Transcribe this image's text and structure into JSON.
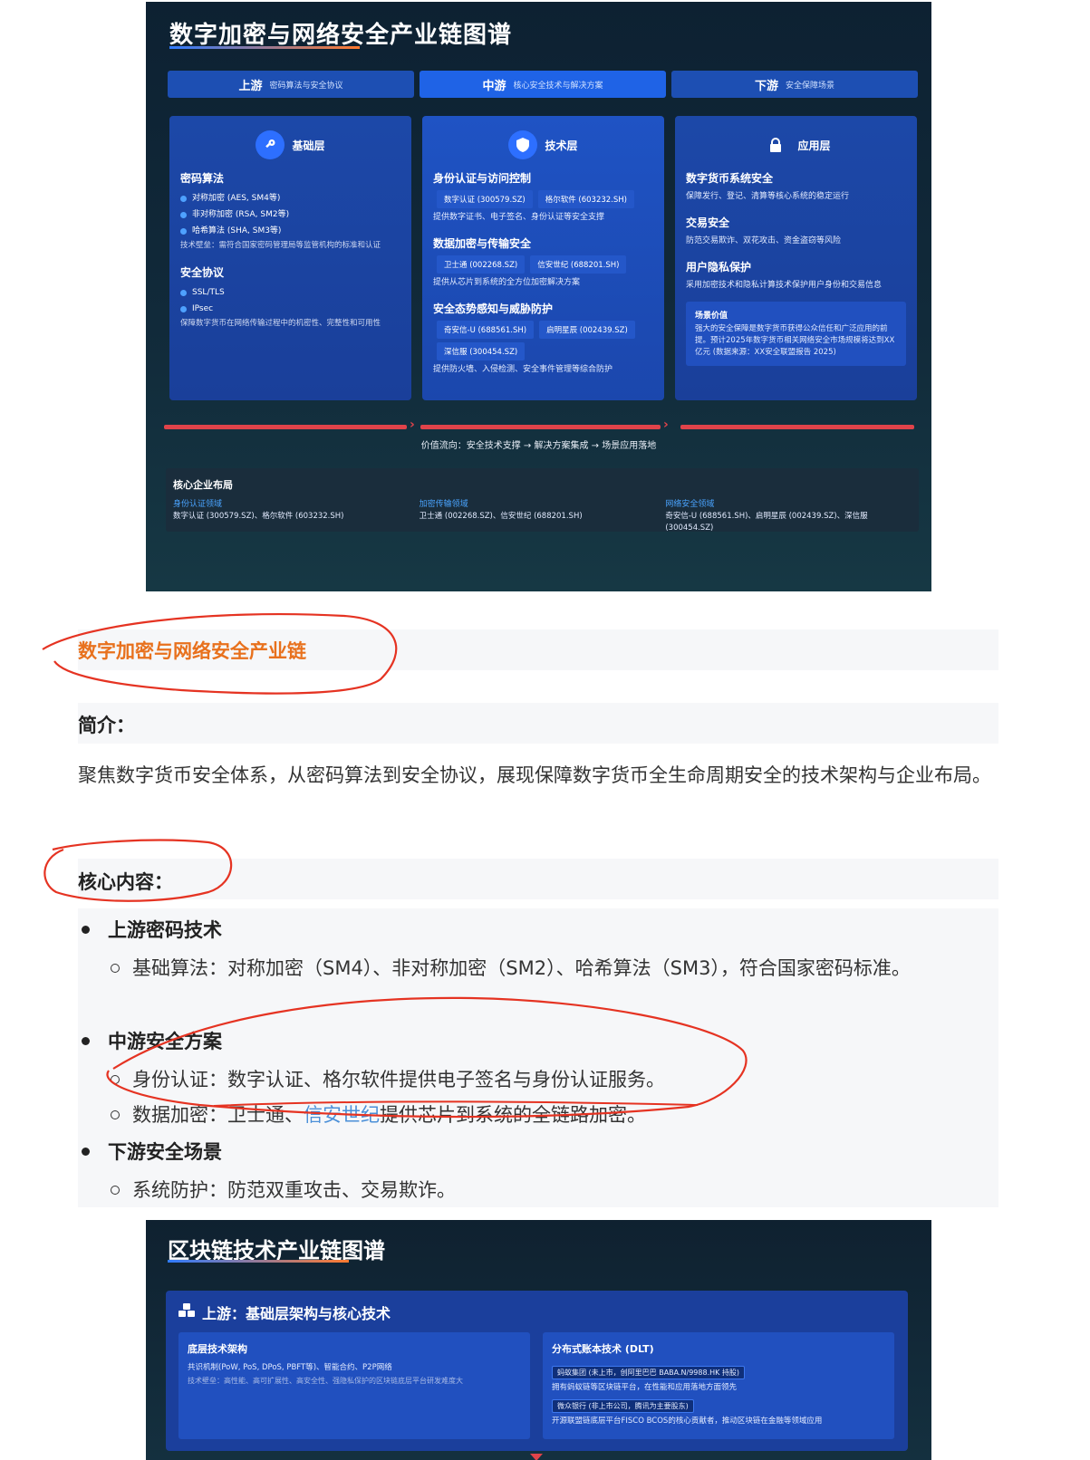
{
  "poster1": {
    "title": "数字加密与网络安全产业链图谱",
    "stages": [
      {
        "name": "上游",
        "desc": "密码算法与安全协议"
      },
      {
        "name": "中游",
        "desc": "核心安全技术与解决方案"
      },
      {
        "name": "下游",
        "desc": "安全保障场景"
      }
    ],
    "columns": {
      "base": {
        "label": "基础层",
        "icon": "key-icon",
        "sec1_title": "密码算法",
        "sec1_items": [
          "对称加密 (AES, SM4等)",
          "非对称加密 (RSA, SM2等)",
          "哈希算法 (SHA, SM3等)"
        ],
        "sec1_note": "技术壁垒：需符合国家密码管理局等监管机构的标准和认证",
        "sec2_title": "安全协议",
        "sec2_items": [
          "SSL/TLS",
          "IPsec"
        ],
        "sec2_note": "保障数字货币在网络传输过程中的机密性、完整性和可用性"
      },
      "tech": {
        "label": "技术层",
        "icon": "shield-icon",
        "s1_title": "身份认证与访问控制",
        "s1_cos": [
          "数字认证 (300579.SZ)",
          "格尔软件 (603232.SH)"
        ],
        "s1_desc": "提供数字证书、电子签名、身份认证等安全支撑",
        "s2_title": "数据加密与传输安全",
        "s2_cos": [
          "卫士通 (002268.SZ)",
          "信安世纪 (688201.SH)"
        ],
        "s2_desc": "提供从芯片到系统的全方位加密解决方案",
        "s3_title": "安全态势感知与威胁防护",
        "s3_cos_a": [
          "奇安信-U (688561.SH)",
          "启明星辰 (002439.SZ)"
        ],
        "s3_cos_b": [
          "深信服 (300454.SZ)"
        ],
        "s3_desc": "提供防火墙、入侵检测、安全事件管理等综合防护"
      },
      "app": {
        "label": "应用层",
        "icon": "lock-icon",
        "a1_title": "数字货币系统安全",
        "a1_desc": "保障发行、登记、清算等核心系统的稳定运行",
        "a2_title": "交易安全",
        "a2_desc": "防范交易欺诈、双花攻击、资金盗窃等风险",
        "a3_title": "用户隐私保护",
        "a3_desc": "采用加密技术和隐私计算技术保护用户身份和交易信息",
        "value_title": "场景价值",
        "value_desc": "强大的安全保障是数字货币获得公众信任和广泛应用的前提。预计2025年数字货币相关网络安全市场规模将达到XX亿元 (数据来源：XX安全联盟报告 2025)"
      }
    },
    "flow_text": "价值流向：安全技术支撑 → 解决方案集成 → 场景应用落地",
    "core": {
      "title": "核心企业布局",
      "fields": [
        {
          "name": "身份认证领域",
          "companies": "数字认证 (300579.SZ)、格尔软件 (603232.SH)"
        },
        {
          "name": "加密传输领域",
          "companies": "卫士通 (002268.SZ)、信安世纪 (688201.SH)"
        },
        {
          "name": "网络安全领域",
          "companies": "奇安信-U (688561.SH)、启明星辰 (002439.SZ)、深信服 (300454.SZ)"
        }
      ]
    }
  },
  "article": {
    "heading": "数字加密与网络安全产业链",
    "intro_label": "简介：",
    "intro_text": "聚焦数字货币安全体系，从密码算法到安全协议，展现保障数字货币全生命周期安全的技术架构与企业布局。",
    "core_label": "核心内容：",
    "sections": [
      {
        "title": "上游密码技术",
        "items": [
          "基础算法：对称加密（SM4）、非对称加密（SM2）、哈希算法（SM3），符合国家密码标准。"
        ]
      },
      {
        "title": "中游安全方案",
        "items": [
          "身份认证：数字认证、格尔软件提供电子签名与身份认证服务。"
        ]
      },
      {
        "title": "下游安全场景",
        "items": [
          "系统防护：防范双重攻击、交易欺诈。"
        ]
      }
    ],
    "item_data_prefix": "数据加密：卫士通、",
    "item_data_link": "信安世纪",
    "item_data_suffix": "提供芯片到系统的全链路加密。"
  },
  "poster2": {
    "title": "区块链技术产业链图谱",
    "panel_title": "上游：基础层架构与核心技术",
    "panel_icon": "blockchain-icon",
    "left": {
      "title": "底层技术架构",
      "line": "共识机制(PoW, PoS, DPoS, PBFT等)、智能合约、P2P网络",
      "sub": "技术壁垒：高性能、高可扩展性、高安全性、强隐私保护的区块链底层平台研发难度大"
    },
    "right": {
      "title": "分布式账本技术 (DLT)",
      "tag1": "蚂蚁集团 (未上市，创阿里巴巴 BABA.N/9988.HK 持股)",
      "line1": "拥有蚂蚁链等区块链平台，在性能和应用落地方面领先",
      "tag2": "微众银行 (非上市公司，腾讯为主要股东)",
      "line2": "开源联盟链底层平台FISCO BCOS的核心贡献者，推动区块链在金融等领域应用"
    }
  }
}
